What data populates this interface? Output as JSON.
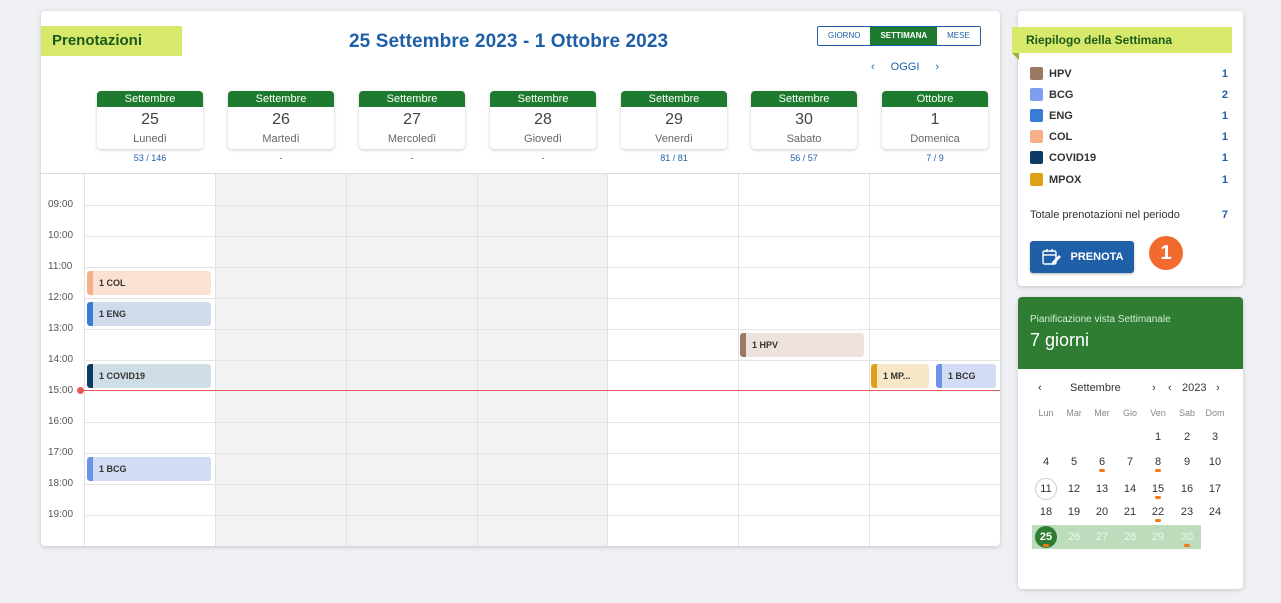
{
  "main": {
    "title": "Prenotazioni",
    "week_range": "25 Settembre 2023 - 1 Ottobre 2023",
    "views": [
      "GIORNO",
      "SETTIMANA",
      "MESE"
    ],
    "active_view": "SETTIMANA",
    "nav": {
      "prev": "‹",
      "today": "OGGI",
      "next": "›"
    },
    "days": [
      {
        "month": "Settembre",
        "num": "25",
        "name": "Lunedì",
        "count": "53 / 146"
      },
      {
        "month": "Settembre",
        "num": "26",
        "name": "Martedì",
        "count": "-"
      },
      {
        "month": "Settembre",
        "num": "27",
        "name": "Mercoledì",
        "count": "-"
      },
      {
        "month": "Settembre",
        "num": "28",
        "name": "Giovedì",
        "count": "-"
      },
      {
        "month": "Settembre",
        "num": "29",
        "name": "Venerdì",
        "count": "81 / 81"
      },
      {
        "month": "Settembre",
        "num": "30",
        "name": "Sabato",
        "count": "56 / 57"
      },
      {
        "month": "Ottobre",
        "num": "1",
        "name": "Domenica",
        "count": "7 / 9"
      }
    ],
    "times": [
      "09:00",
      "10:00",
      "11:00",
      "12:00",
      "13:00",
      "14:00",
      "15:00",
      "16:00",
      "17:00",
      "18:00",
      "19:00"
    ],
    "events": {
      "col": {
        "label": "1 COL",
        "color": "#f5b08a"
      },
      "eng": {
        "label": "1 ENG",
        "color": "#3a7bd5"
      },
      "covid": {
        "label": "1 COVID19",
        "color": "#0d3b66"
      },
      "bcg1": {
        "label": "1 BCG",
        "color": "#6b93e8"
      },
      "hpv": {
        "label": "1 HPV",
        "color": "#9b7a64"
      },
      "mpox": {
        "label": "1 MP...",
        "color": "#e0a01a"
      },
      "bcg2": {
        "label": "1 BCG",
        "color": "#6b93e8"
      }
    }
  },
  "summary": {
    "title": "Riepilogo della Settimana",
    "items": [
      {
        "name": "HPV",
        "count": "1",
        "color": "#9b7a64"
      },
      {
        "name": "BCG",
        "count": "2",
        "color": "#7e9ef0"
      },
      {
        "name": "ENG",
        "count": "1",
        "color": "#3a7bd5"
      },
      {
        "name": "COL",
        "count": "1",
        "color": "#f5b08a"
      },
      {
        "name": "COVID19",
        "count": "1",
        "color": "#0d3b66"
      },
      {
        "name": "MPOX",
        "count": "1",
        "color": "#e0a01a"
      }
    ],
    "total_label": "Totale prenotazioni nel periodo",
    "total_value": "7",
    "button_label": "PRENOTA",
    "badge": "1"
  },
  "planning": {
    "subtitle": "Pianificazione vista Settimanale",
    "main": "7 giorni",
    "month": "Settembre",
    "year": "2023",
    "weekdays": [
      "Lun",
      "Mar",
      "Mer",
      "Gio",
      "Ven",
      "Sab",
      "Dom"
    ],
    "rows": [
      [
        "",
        "",
        "",
        "",
        "1",
        "2",
        "3"
      ],
      [
        "4",
        "5",
        "6",
        "7",
        "8",
        "9",
        "10"
      ],
      [
        "11",
        "12",
        "13",
        "14",
        "15",
        "16",
        "17"
      ],
      [
        "18",
        "19",
        "20",
        "21",
        "22",
        "23",
        "24"
      ],
      [
        "25",
        "26",
        "27",
        "28",
        "29",
        "30",
        ""
      ]
    ]
  }
}
